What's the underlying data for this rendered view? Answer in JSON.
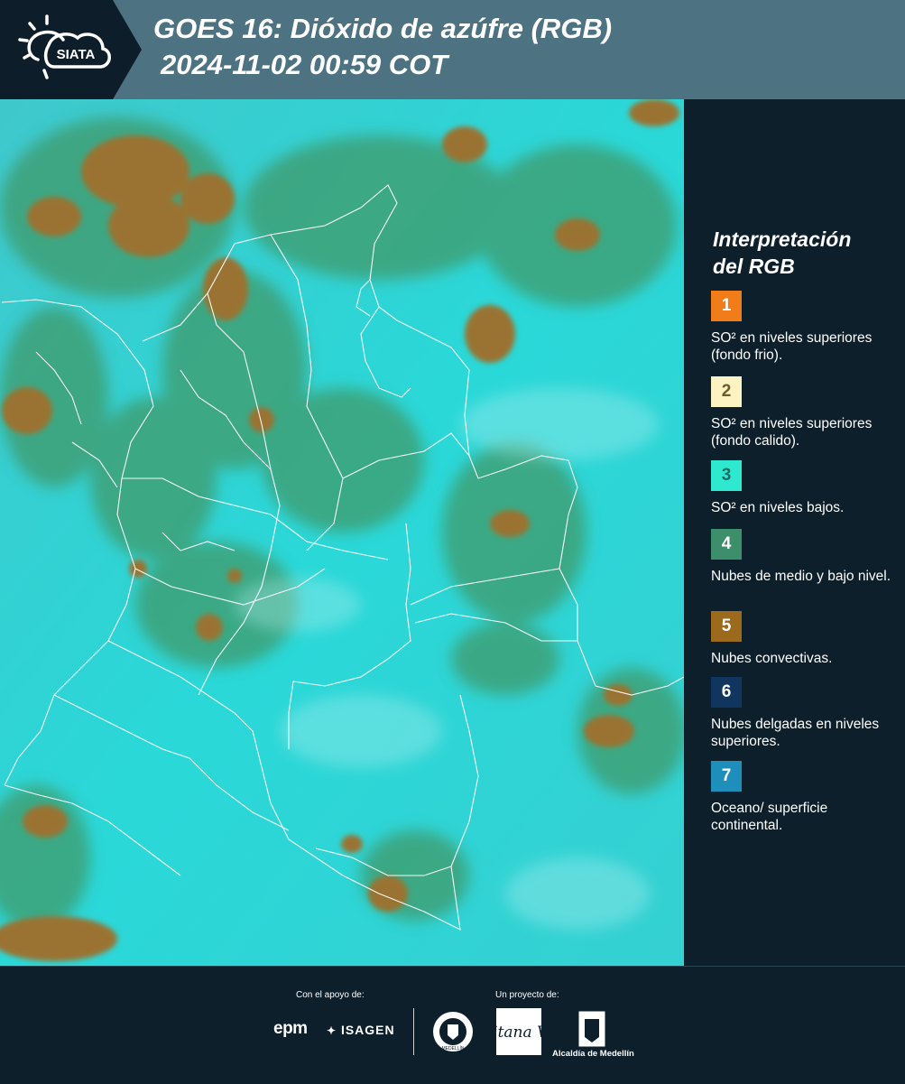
{
  "header": {
    "logo_text": "SIATA",
    "title_line1": "GOES 16: Dióxido de azúfre (RGB)",
    "title_line2": "2024-11-02 00:59 COT"
  },
  "legend": {
    "title_line1": "Interpretación",
    "title_line2": "del RGB",
    "items": [
      {
        "num": "1",
        "label": "SO² en niveles superiores (fondo frio).",
        "color": "#f07d1a"
      },
      {
        "num": "2",
        "label": "SO² en niveles superiores (fondo calido).",
        "color": "#fcf3c2"
      },
      {
        "num": "3",
        "label": "SO² en niveles bajos.",
        "color": "#2ee9cf"
      },
      {
        "num": "4",
        "label": "Nubes de medio y bajo nivel.",
        "color": "#3d8f6c"
      },
      {
        "num": "5",
        "label": "Nubes convectivas.",
        "color": "#9c6a1c"
      },
      {
        "num": "6",
        "label": "Nubes delgadas en niveles superiores.",
        "color": "#10355f"
      },
      {
        "num": "7",
        "label": "Oceano/ superficie continental.",
        "color": "#1e8fba"
      }
    ]
  },
  "footer": {
    "support_label": "Con el apoyo de:",
    "project_label": "Un proyecto de:",
    "sponsors": [
      "epm",
      "ISAGEN"
    ],
    "partners": [
      "MEDELLÍN",
      "Área Metropolitana Valle de Aburrá",
      "Alcaldía de Medellín"
    ]
  },
  "colors": {
    "header_band": "#4d7282",
    "background": "#0c1f2b",
    "land_cloud": "#3f9a6a",
    "convective": "#9a7330",
    "ocean_low": "#2ad6d6"
  }
}
